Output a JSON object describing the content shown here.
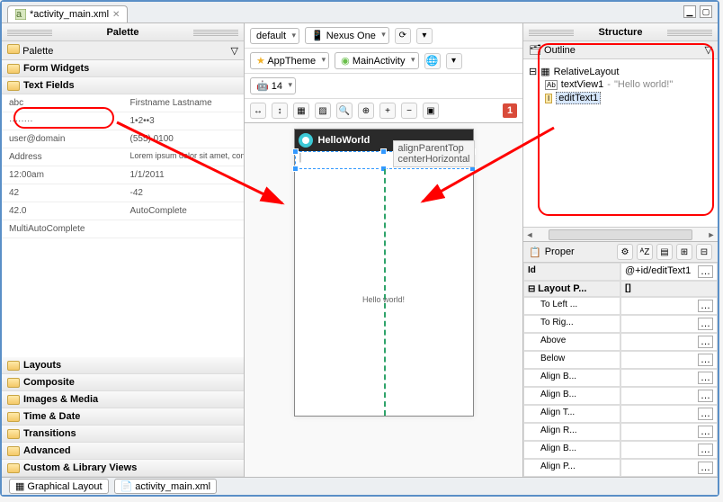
{
  "tab": {
    "file": "*activity_main.xml"
  },
  "palette": {
    "title": "Palette",
    "sub": "Palette",
    "folders": {
      "form_widgets": "Form Widgets",
      "text_fields": "Text Fields",
      "layouts": "Layouts",
      "composite": "Composite",
      "images_media": "Images & Media",
      "time_date": "Time & Date",
      "transitions": "Transitions",
      "advanced": "Advanced",
      "custom": "Custom & Library Views"
    },
    "text_fields_items": {
      "c0": [
        "abc",
        "········",
        "user@domain",
        "Address",
        "12:00am",
        "42",
        "42.0",
        "MultiAutoComplete"
      ],
      "c1": [
        "Firstname Lastname",
        "1•2••3",
        "(555) 0100",
        "Lorem ipsum dolor sit amet, consectetur adipisicing elit, sed do eiusmod tempor",
        "1/1/2011",
        "-42",
        "AutoComplete",
        ""
      ]
    }
  },
  "editor": {
    "config": "default",
    "device": "Nexus One",
    "theme": "AppTheme",
    "activity": "MainActivity",
    "api": "14",
    "badge": "1",
    "hint1": "alignParentTop",
    "hint2": "centerHorizontal"
  },
  "phone": {
    "app_title": "HelloWorld",
    "hello_text": "Hello world!"
  },
  "structure": {
    "title": "Structure",
    "outline": "Outline",
    "root": "RelativeLayout",
    "tv": {
      "name": "textView1",
      "val": "\"Hello world!\""
    },
    "et": {
      "name": "editText1"
    }
  },
  "props": {
    "title": "Proper",
    "hdr_id": "Id",
    "id_val": "@+id/editText1",
    "layout_p": "Layout P...",
    "layout_p_val": "[]",
    "rows": [
      "To Left ...",
      "To Rig...",
      "Above",
      "Below",
      "Align B...",
      "Align B...",
      "Align T...",
      "Align R...",
      "Align B...",
      "Align P..."
    ]
  },
  "bottom": {
    "graphical": "Graphical Layout",
    "xml": "activity_main.xml"
  }
}
